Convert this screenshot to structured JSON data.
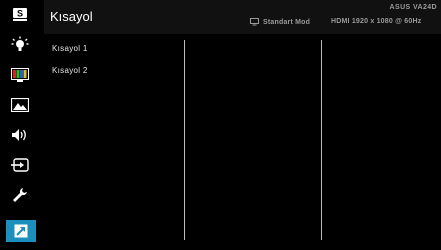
{
  "header": {
    "title": "Kısayol",
    "model": "ASUS VA24D",
    "mode": "Standart Mod",
    "signal": "HDMI 1920 x 1080 @ 60Hz"
  },
  "sidebar": {
    "items": [
      {
        "icon": "splendid-icon",
        "label": "S"
      },
      {
        "icon": "blue-light-filter-icon"
      },
      {
        "icon": "color-icon"
      },
      {
        "icon": "image-icon"
      },
      {
        "icon": "sound-icon"
      },
      {
        "icon": "input-select-icon"
      },
      {
        "icon": "system-setup-icon"
      },
      {
        "icon": "shortcut-icon",
        "active": true
      }
    ]
  },
  "menu": {
    "options": [
      "Kısayol 1",
      "Kısayol 2"
    ]
  },
  "colors": {
    "accent": "#1c8fbd",
    "header_bg": "#111111",
    "text": "#e6e6e6",
    "subtext": "#9a9a9a"
  }
}
